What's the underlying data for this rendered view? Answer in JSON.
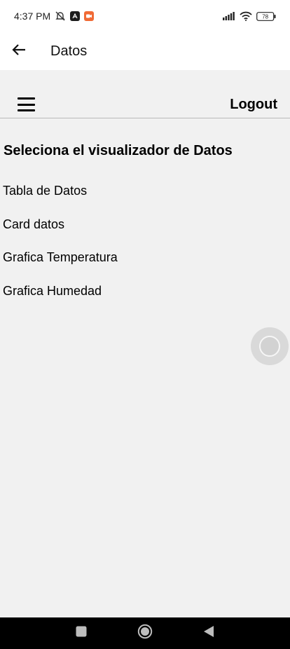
{
  "status_bar": {
    "time": "4:37 PM",
    "battery": "78",
    "icons": [
      "mute-icon",
      "app-notification-icon",
      "camera-notification-icon",
      "signal-icon",
      "wifi-icon",
      "battery-icon"
    ],
    "accent_notification_color": "#f06a35"
  },
  "app_bar": {
    "title": "Datos",
    "back_icon": "arrow-left-icon"
  },
  "toolbar": {
    "menu_icon": "hamburger-menu-icon",
    "logout_label": "Logout"
  },
  "content": {
    "heading": "Seleciona el visualizador de Datos",
    "items": [
      {
        "label": "Tabla de Datos"
      },
      {
        "label": "Card datos"
      },
      {
        "label": "Grafica Temperatura"
      },
      {
        "label": "Grafica Humedad"
      }
    ]
  },
  "floating_button": {
    "icon": "assistive-touch-icon"
  },
  "nav_bar": {
    "buttons": [
      "recents-square-icon",
      "home-circle-icon",
      "back-triangle-icon"
    ]
  },
  "colors": {
    "background": "#f1f1f1",
    "surface": "#ffffff",
    "nav_bar": "#000000"
  }
}
